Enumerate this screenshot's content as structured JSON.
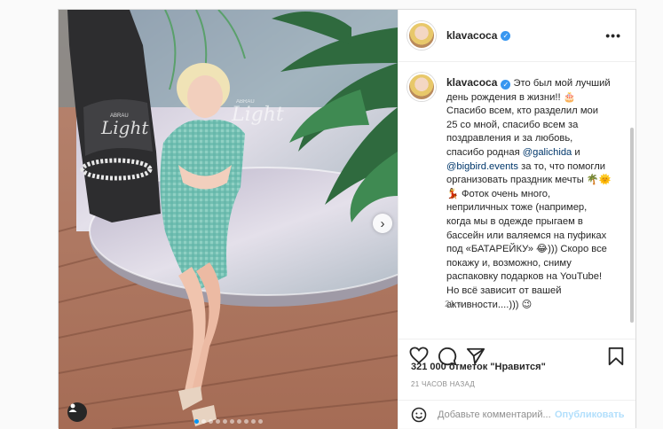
{
  "header": {
    "username": "klavacoca",
    "verified_badge": "✓",
    "more_icon": "more-horizontal-icon"
  },
  "photo": {
    "next_arrow": "›",
    "brand_text_1": "Light",
    "brand_text_2": "Light",
    "brand_small_1": "ABRAU",
    "brand_small_2": "ABRAU",
    "carousel_count": 10,
    "carousel_active": 1
  },
  "caption": {
    "username": "klavacoca",
    "text_1": " Это был мой лучший день рождения в жизни!! 🎂 Спасибо всем, кто разделил мои 25 со мной, спасибо всем за поздравления и за любовь, спасибо родная ",
    "mention_1": "@galichida",
    "text_2": " и ",
    "mention_2": "@bigbird.events",
    "text_3": " за то, что помогли организовать праздник мечты 🌴🌞💃 Фоток очень много, неприличных тоже (например, когда мы в одежде прыгаем в бассейн или валяемся на пуфиках под «БАТАРЕЙКУ» 😂))) Скоро все покажу и, возможно, сниму распаковку подарков на YouTube! Но всё зависит от вашей активности....))) 😉",
    "time": "21 ч."
  },
  "actions": {
    "icons": [
      "heart-icon",
      "comment-icon",
      "share-icon",
      "bookmark-icon"
    ]
  },
  "likes": {
    "text": "321 000 отметок \"Нравится\""
  },
  "date": "21 ЧАСОВ НАЗАД",
  "comment": {
    "placeholder": "Добавьте комментарий...",
    "publish_label": "Опубликовать"
  },
  "colors": {
    "accent": "#0095f6",
    "verified": "#3897f0",
    "link": "#00376b",
    "publish_disabled": "#b2dffc"
  }
}
